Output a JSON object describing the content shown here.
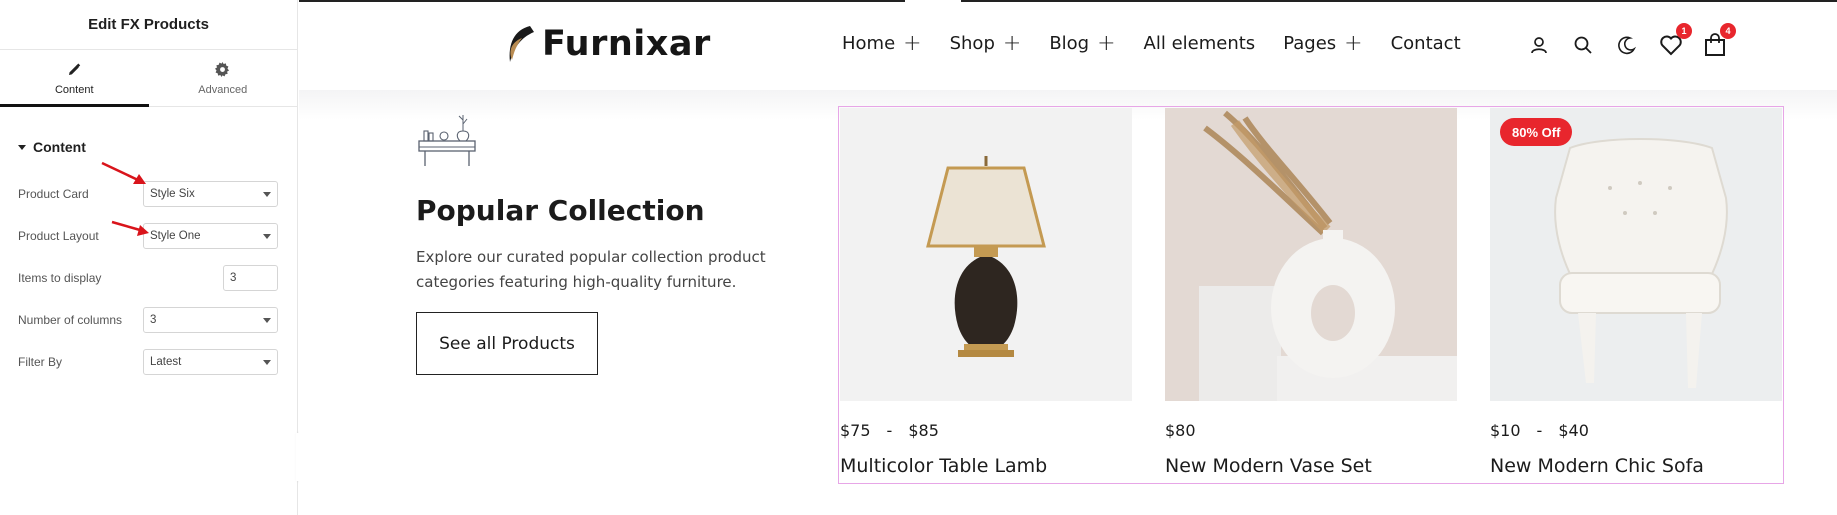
{
  "editor": {
    "title": "Edit FX Products",
    "tabs": [
      {
        "label": "Content",
        "icon": "pencil-icon"
      },
      {
        "label": "Advanced",
        "icon": "gear-icon"
      }
    ],
    "section_title": "Content",
    "controls": {
      "product_card": {
        "label": "Product Card",
        "value": "Style Six"
      },
      "product_layout": {
        "label": "Product Layout",
        "value": "Style One"
      },
      "items_to_display": {
        "label": "Items to display",
        "value": "3"
      },
      "number_of_columns": {
        "label": "Number of columns",
        "value": "3"
      },
      "filter_by": {
        "label": "Filter By",
        "value": "Latest"
      }
    },
    "collapse_icon": "chevron-left-icon",
    "annotation_color": "#d9141b"
  },
  "site": {
    "logo_text": "Furnixar",
    "nav": [
      {
        "label": "Home",
        "has_submenu": true
      },
      {
        "label": "Shop",
        "has_submenu": true
      },
      {
        "label": "Blog",
        "has_submenu": true
      },
      {
        "label": "All elements",
        "has_submenu": false
      },
      {
        "label": "Pages",
        "has_submenu": true
      },
      {
        "label": "Contact",
        "has_submenu": false
      }
    ],
    "plus": "+",
    "header_icons": {
      "account": "user-icon",
      "search": "search-icon",
      "theme": "moon-icon",
      "wishlist": {
        "icon": "heart-icon",
        "count": "1"
      },
      "cart": {
        "icon": "bag-icon",
        "count": "4"
      }
    },
    "section": {
      "title": "Popular Collection",
      "description": "Explore our curated popular collection product categories featuring high-quality furniture.",
      "button_label": "See all Products"
    },
    "products": [
      {
        "price_from": "$75",
        "price_sep": "-",
        "price_to": "$85",
        "name": "Multicolor Table Lamb",
        "badge": ""
      },
      {
        "price": "$80",
        "name": "New Modern Vase Set",
        "badge": ""
      },
      {
        "price_from": "$10",
        "price_sep": "-",
        "price_to": "$40",
        "name": "New Modern Chic Sofa",
        "badge": "80% Off"
      }
    ],
    "colors": {
      "accent_badge": "#e8262d",
      "selection_border": "#e7a6e7",
      "text": "#1b1b1b"
    }
  }
}
